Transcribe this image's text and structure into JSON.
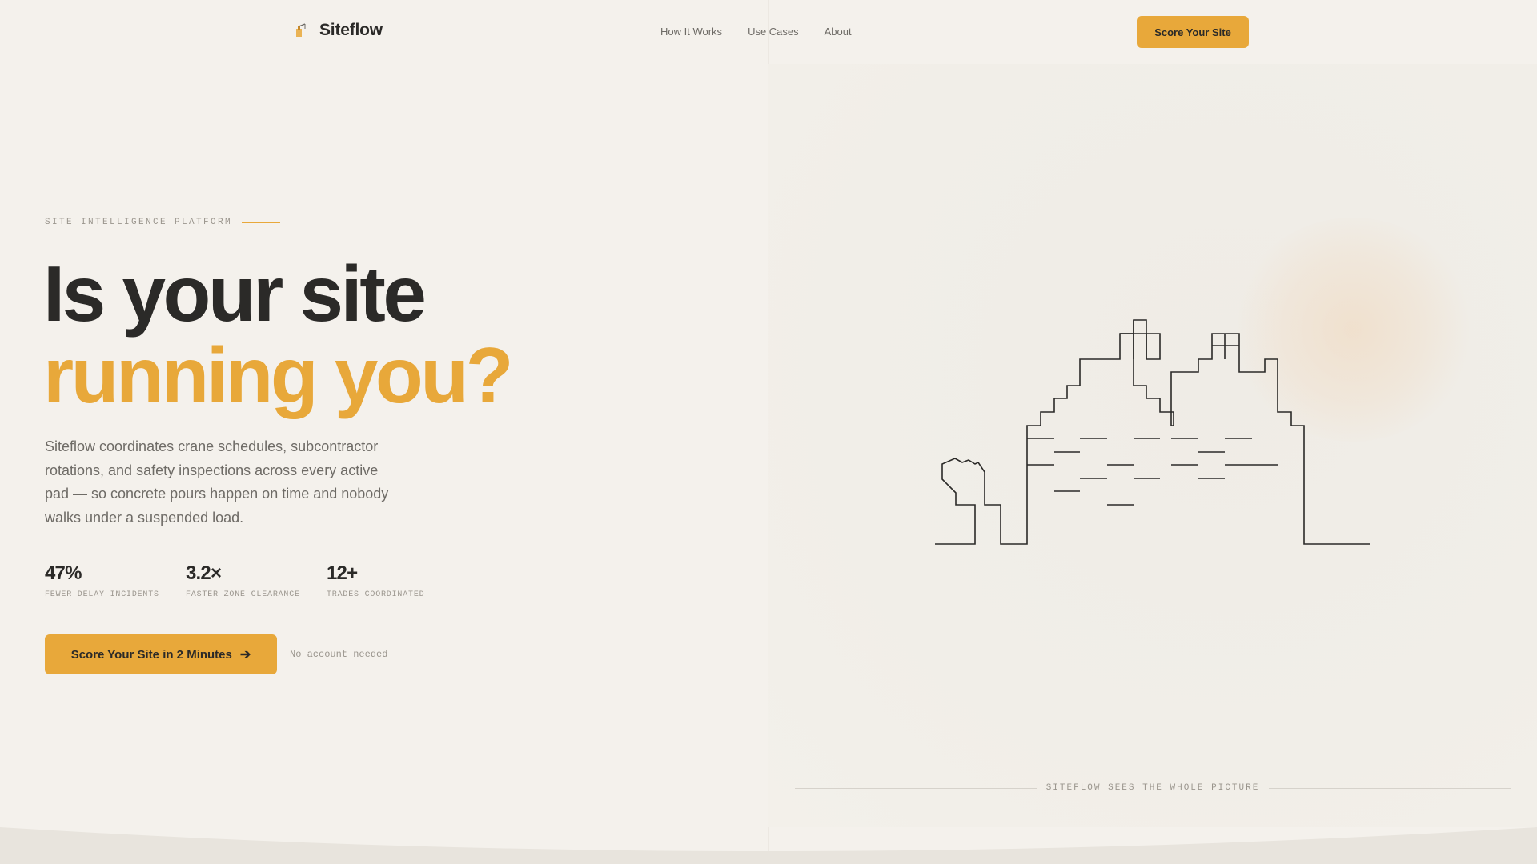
{
  "header": {
    "brand_name": "Siteflow",
    "brand_icon": "crane-icon",
    "nav": [
      "How It Works",
      "Use Cases",
      "About"
    ],
    "cta_label": "Score Your Site"
  },
  "hero": {
    "eyebrow": "SITE INTELLIGENCE PLATFORM",
    "headline_line1": "Is your site",
    "headline_line2": "running you?",
    "lead": "Siteflow coordinates crane schedules, subcontractor rotations, and safety inspections across every active pad — so concrete pours happen on time and nobody walks under a suspended load.",
    "stats": [
      {
        "value": "47%",
        "label": "FEWER DELAY INCIDENTS"
      },
      {
        "value": "3.2×",
        "label": "FASTER ZONE CLEARANCE"
      },
      {
        "value": "12+",
        "label": "TRADES COORDINATED"
      }
    ],
    "cta_label": "Score Your Site in 2 Minutes",
    "cta_note": "No account needed"
  },
  "panel": {
    "caption": "SITEFLOW SEES THE WHOLE PICTURE",
    "illustration": "city-skyline-line-drawing"
  },
  "colors": {
    "background": "#f4f1ec",
    "accent": "#e8a83a",
    "text": "#2b2a28",
    "muted": "#6e6b66"
  }
}
